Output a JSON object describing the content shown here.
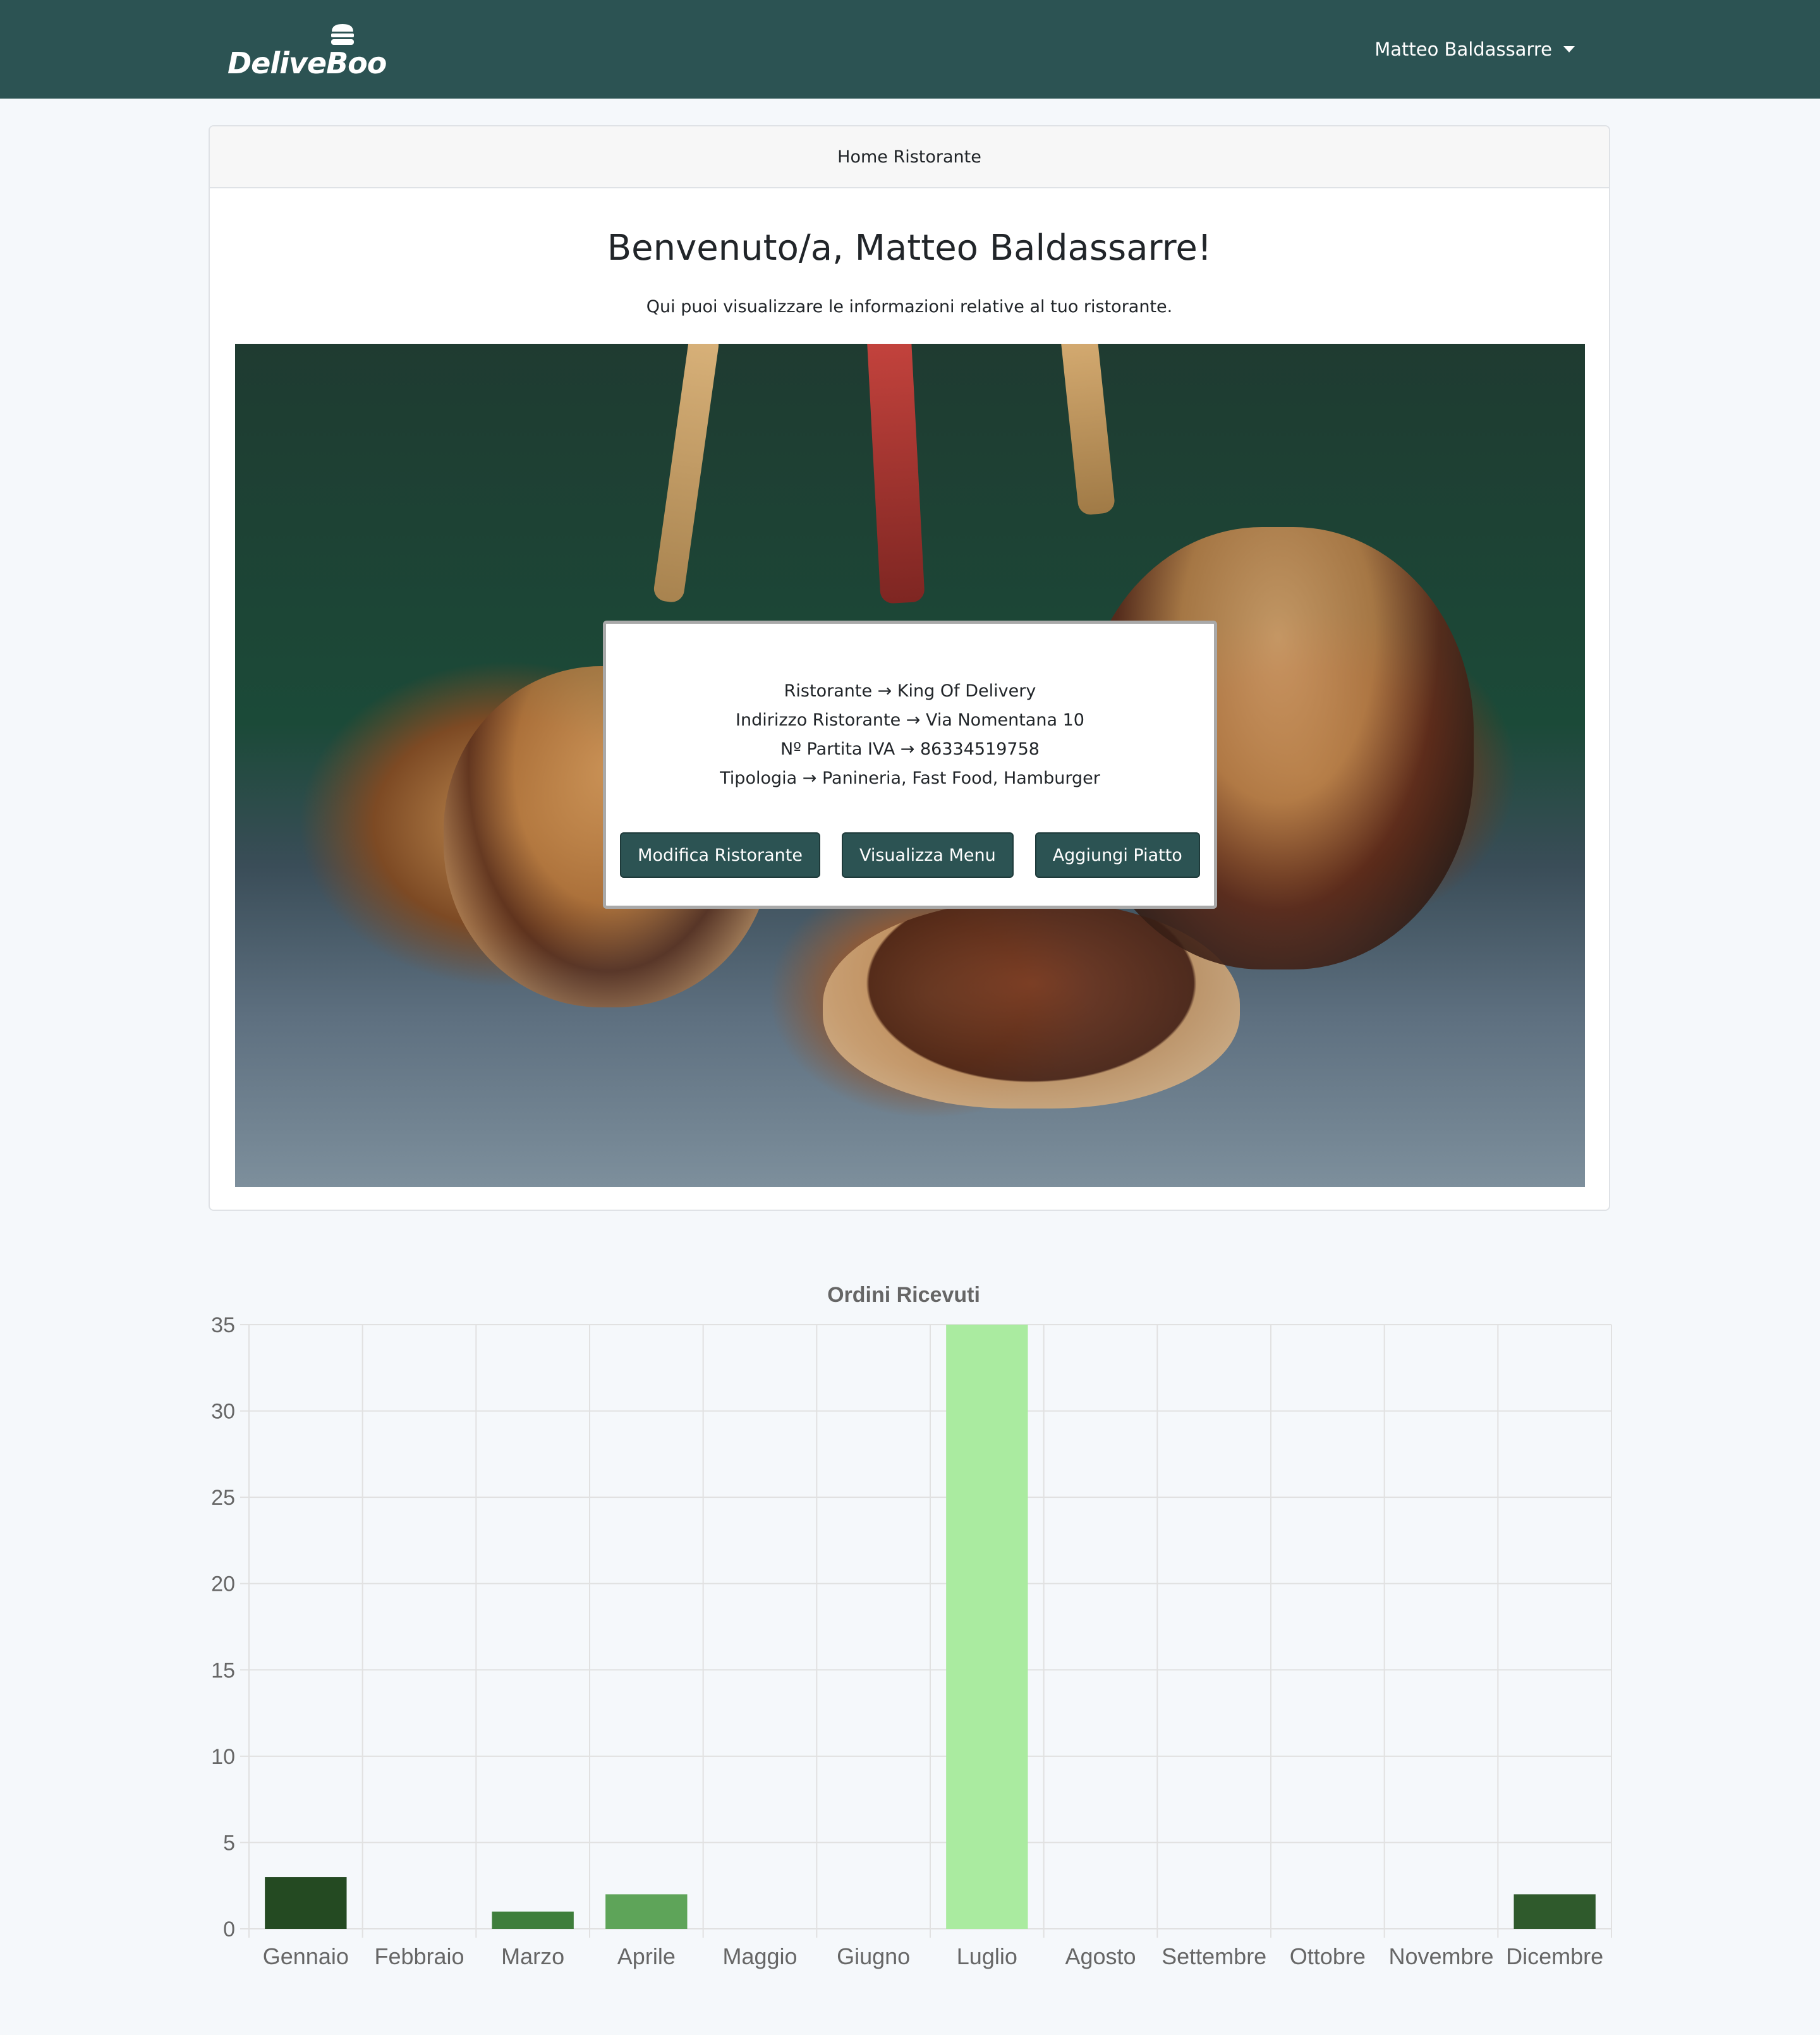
{
  "navbar": {
    "brand": "DeliveBoo",
    "user_name": "Matteo Baldassarre",
    "icons": {
      "brand": "burger-icon",
      "user_menu": "chevron-down-icon"
    },
    "background": "#2c5353"
  },
  "card": {
    "header": "Home Ristorante",
    "welcome": "Benvenuto/a, Matteo Baldassarre!",
    "subtitle": "Qui puoi visualizzare le informazioni relative al tuo ristorante."
  },
  "restaurant": {
    "name_line": "Ristorante → King Of Delivery",
    "address_line": "Indirizzo Ristorante → Via Nomentana 10",
    "vat_line": "Nº Partita IVA → 86334519758",
    "type_line": "Tipologia → Panineria, Fast Food, Hamburger"
  },
  "actions": {
    "edit": "Modifica Ristorante",
    "menu": "Visualizza Menu",
    "add_dish": "Aggiungi Piatto"
  },
  "chart_data": {
    "type": "bar",
    "title": "Ordini Ricevuti",
    "categories": [
      "Gennaio",
      "Febbraio",
      "Marzo",
      "Aprile",
      "Maggio",
      "Giugno",
      "Luglio",
      "Agosto",
      "Settembre",
      "Ottobre",
      "Novembre",
      "Dicembre"
    ],
    "values": [
      3,
      0,
      1,
      2,
      0,
      0,
      35,
      0,
      0,
      0,
      0,
      2
    ],
    "bar_colors": [
      "#244a22",
      "#244a22",
      "#3e7e3b",
      "#5ea459",
      "#5ea459",
      "#5ea459",
      "#aaeba0",
      "#244a22",
      "#244a22",
      "#244a22",
      "#244a22",
      "#2f5a2c"
    ],
    "ylim": [
      0,
      35
    ],
    "yticks": [
      0,
      5,
      10,
      15,
      20,
      25,
      30,
      35
    ],
    "grid": true,
    "legend": "none"
  }
}
